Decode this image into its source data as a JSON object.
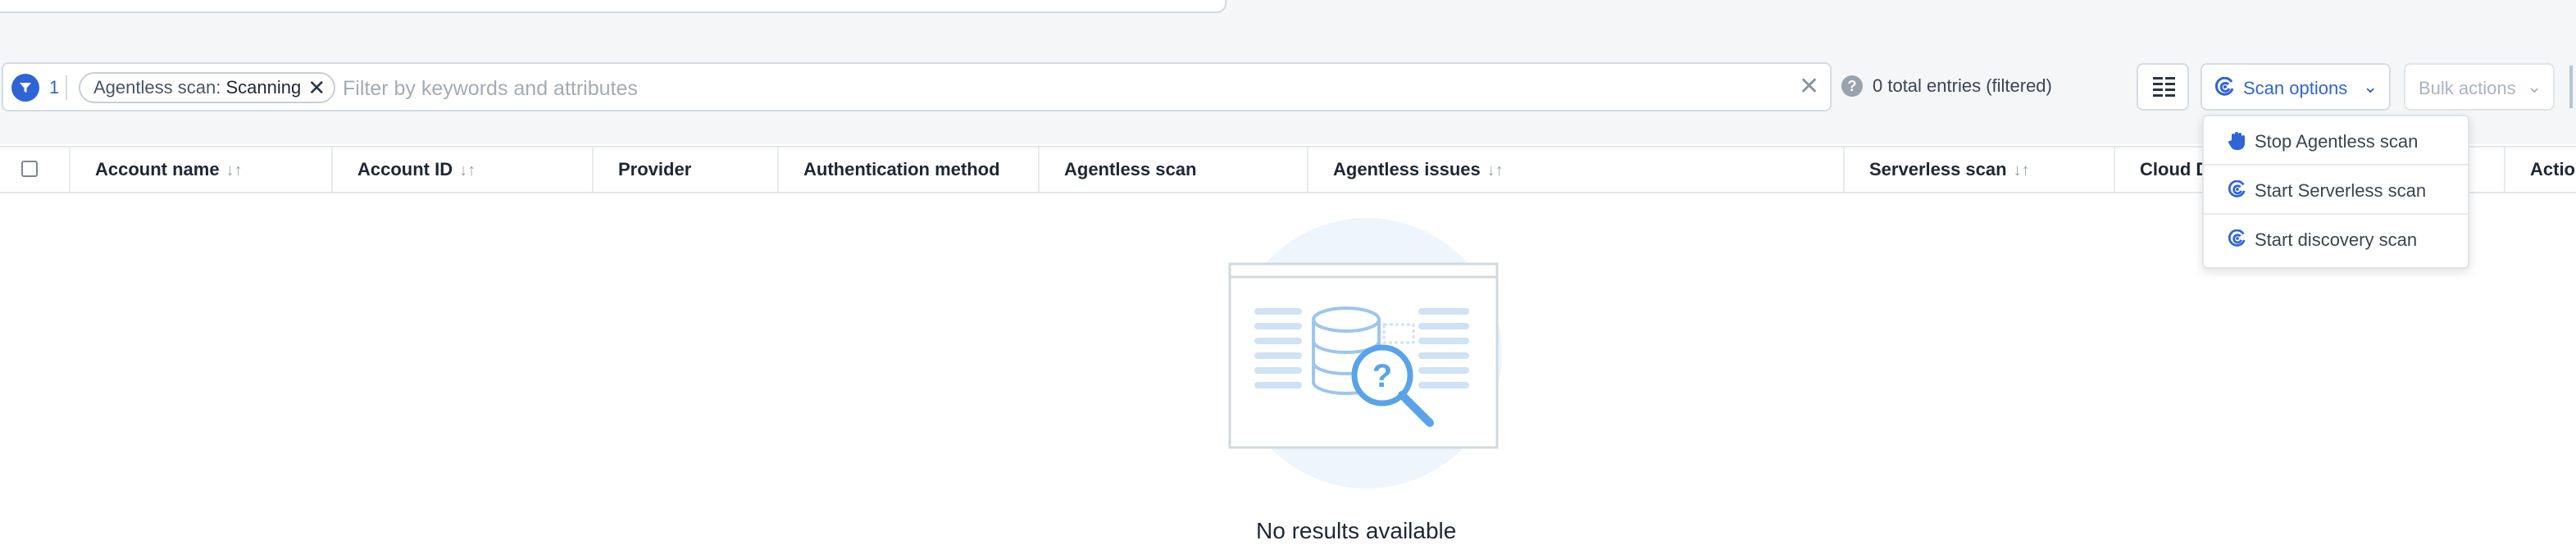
{
  "filter_bar": {
    "active_filter_count": "1",
    "chip_key": "Agentless scan:",
    "chip_value": "Scanning",
    "chip_remove": "✕",
    "placeholder": "Filter by keywords and attributes",
    "clear": "✕"
  },
  "entries": {
    "help_icon": "?",
    "text": "0 total entries (filtered)"
  },
  "toolbar": {
    "scan_options_label": "Scan options",
    "bulk_actions_label": "Bulk actions",
    "chevron": "⌄"
  },
  "table": {
    "columns": [
      {
        "label": "Account name",
        "sortable": true
      },
      {
        "label": "Account ID",
        "sortable": true
      },
      {
        "label": "Provider",
        "sortable": false
      },
      {
        "label": "Authentication method",
        "sortable": false
      },
      {
        "label": "Agentless scan",
        "sortable": false
      },
      {
        "label": "Agentless issues",
        "sortable": true
      },
      {
        "label": "Serverless scan",
        "sortable": true
      },
      {
        "label": "Cloud D",
        "sortable": false
      },
      {
        "label": "Actio",
        "sortable": false
      }
    ],
    "sort_glyph": "↓↑"
  },
  "scan_menu": {
    "items": [
      {
        "label": "Stop Agentless scan",
        "icon": "stop-hand-icon"
      },
      {
        "label": "Start Serverless scan",
        "icon": "scan-icon"
      },
      {
        "label": "Start discovery scan",
        "icon": "scan-icon"
      }
    ]
  },
  "empty_state": {
    "text": "No results available"
  },
  "colors": {
    "accent": "#2f64d6",
    "muted": "#9aa2ac",
    "illustration": "#b9d7f5"
  }
}
